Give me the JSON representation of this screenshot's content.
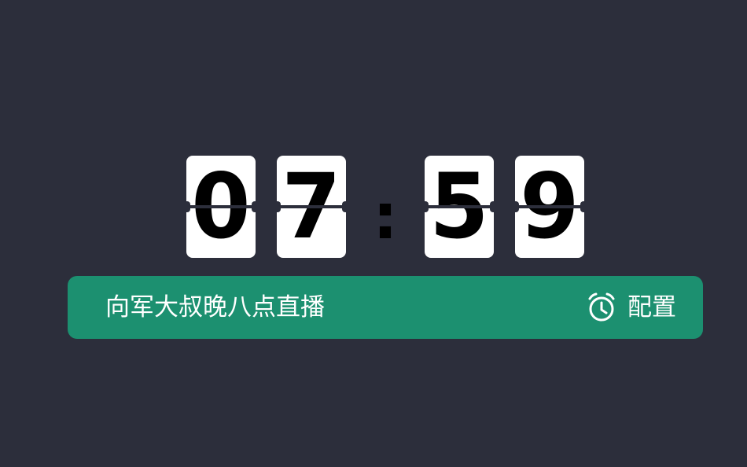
{
  "clock": {
    "hour_tens": "0",
    "hour_ones": "7",
    "separator": ":",
    "minute_tens": "5",
    "minute_ones": "9"
  },
  "banner": {
    "title": "向军大叔晚八点直播",
    "config_label": "配置",
    "config_icon": "alarm-clock-icon"
  },
  "colors": {
    "background": "#2c2e3b",
    "banner": "#1c9070",
    "card": "#ffffff",
    "digit": "#000000"
  }
}
